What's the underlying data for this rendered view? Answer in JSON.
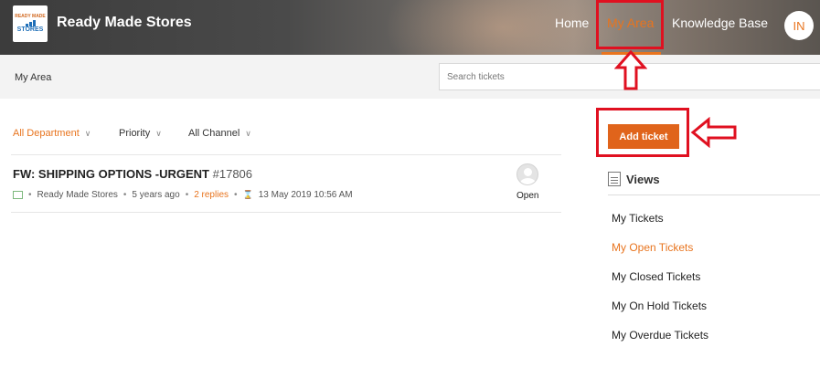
{
  "header": {
    "logo": {
      "line1": "READY MADE",
      "line2": "STORES"
    },
    "brand": "Ready Made Stores",
    "nav": [
      {
        "label": "Home"
      },
      {
        "label": "My Area"
      },
      {
        "label": "Knowledge Base"
      }
    ],
    "avatar_initials": "IN"
  },
  "subbar": {
    "breadcrumb": "My Area",
    "search_placeholder": "Search tickets"
  },
  "filters": [
    {
      "label": "All Department"
    },
    {
      "label": "Priority"
    },
    {
      "label": "All Channel"
    }
  ],
  "ticket": {
    "title": "FW: SHIPPING OPTIONS -URGENT",
    "number": "#17806",
    "company": "Ready Made Stores",
    "age": "5 years ago",
    "replies": "2 replies",
    "due": "13 May 2019 10:56 AM",
    "status": "Open"
  },
  "sidebar": {
    "add_ticket": "Add ticket",
    "views_title": "Views",
    "views": [
      {
        "label": "My Tickets"
      },
      {
        "label": "My Open Tickets"
      },
      {
        "label": "My Closed Tickets"
      },
      {
        "label": "My On Hold Tickets"
      },
      {
        "label": "My Overdue Tickets"
      }
    ]
  },
  "colors": {
    "accent": "#e8741e",
    "button": "#e0641b",
    "annotation": "#e01020"
  }
}
